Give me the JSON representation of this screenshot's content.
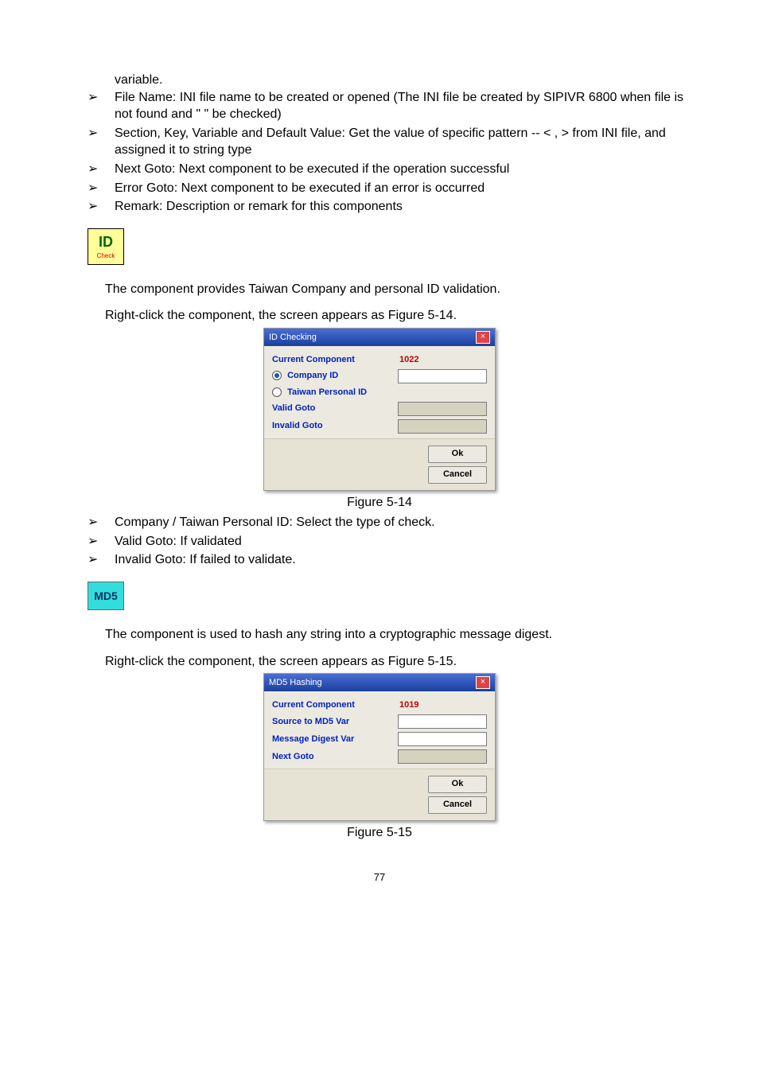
{
  "bullets_top_pre": "variable.",
  "bullets_top": [
    "File Name: INI file name to be created or opened (The INI file be created by SIPIVR 6800 when file is not found and \"                                        \" be checked)",
    "Section, Key, Variable and Default Value: Get the value of specific pattern -- <            ,                                   > from INI file, and assigned it to string type",
    "Next Goto: Next component to be executed if the operation successful",
    "Error Goto: Next component to be executed if an error is occurred",
    "Remark: Description or remark for this components"
  ],
  "id_icon": {
    "top": "ID",
    "bottom": "Check"
  },
  "para_id1": "The                          component provides Taiwan Company and personal ID validation.",
  "para_id2": "Right-click the                          component, the screen appears as Figure 5-14.",
  "dialog_id": {
    "title": "ID Checking",
    "current_label": "Current Component",
    "current_value": "1022",
    "radio1": "Company ID",
    "radio2": "Taiwan Personal ID",
    "valid": "Valid  Goto",
    "invalid": "Invalid  Goto",
    "ok": "Ok",
    "cancel": "Cancel"
  },
  "fig514": "Figure 5-14",
  "bullets_mid": [
    "Company / Taiwan Personal ID: Select the type of check.",
    "Valid Goto: If validated",
    "Invalid Goto: If failed to validate."
  ],
  "md5_icon": "MD5",
  "para_md1": "The                          component is used to hash any string into a cryptographic message digest.",
  "para_md2": "Right-click the                               component, the screen appears as Figure 5-15.",
  "dialog_md5": {
    "title": "MD5 Hashing",
    "current_label": "Current Component",
    "current_value": "1019",
    "src": "Source to MD5 Var",
    "digest": "Message Digest Var",
    "next": "Next Goto",
    "ok": "Ok",
    "cancel": "Cancel"
  },
  "fig515": "Figure 5-15",
  "page": "77"
}
